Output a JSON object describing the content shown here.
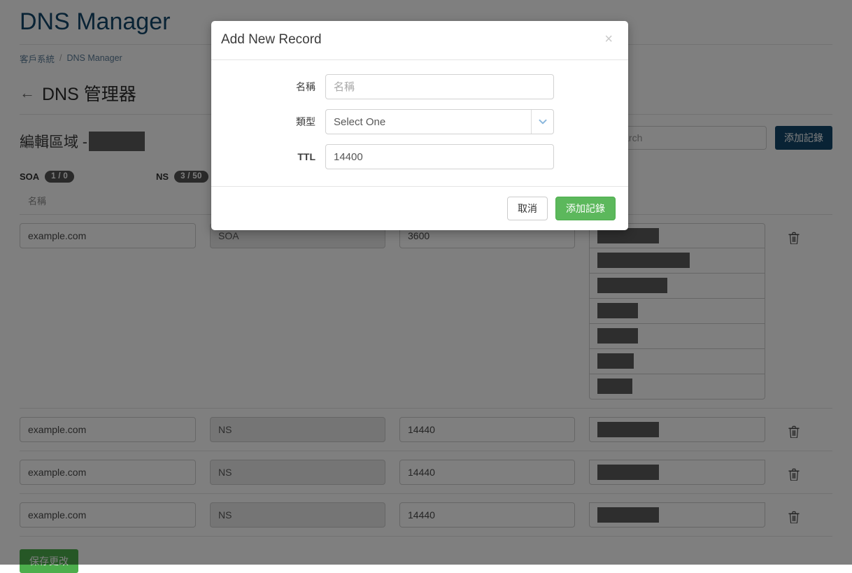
{
  "page": {
    "title": "DNS Manager",
    "breadcrumb": {
      "root": "客戶系統",
      "separator": "/",
      "current": "DNS Manager"
    },
    "subheader": {
      "back_icon": "left-arrow-icon",
      "label": "DNS 管理器"
    },
    "zone": {
      "label": "編輯區域 -",
      "name_redacted": true
    },
    "search": {
      "placeholder": "Search",
      "value": ""
    },
    "add_record_button": "添加記錄",
    "save_button": "保存更改",
    "counts": [
      {
        "type": "SOA",
        "badge": "1 / 0"
      },
      {
        "type": "NS",
        "badge": "3 / 50"
      }
    ],
    "columns": [
      "名稱",
      "",
      "",
      "",
      ""
    ],
    "records": [
      {
        "name": "example.com",
        "type": "SOA",
        "ttl": "3600",
        "values": [
          {
            "redacted_width": 88
          },
          {
            "redacted_width": 132
          },
          {
            "redacted_width": 100
          },
          {
            "redacted_width": 58
          },
          {
            "redacted_width": 58
          },
          {
            "redacted_width": 52
          },
          {
            "redacted_width": 50
          }
        ],
        "delete_icon": "trash-icon"
      },
      {
        "name": "example.com",
        "type": "NS",
        "ttl": "14440",
        "values": [
          {
            "redacted_width": 88
          }
        ],
        "delete_icon": "trash-icon"
      },
      {
        "name": "example.com",
        "type": "NS",
        "ttl": "14440",
        "values": [
          {
            "redacted_width": 88
          }
        ],
        "delete_icon": "trash-icon"
      },
      {
        "name": "example.com",
        "type": "NS",
        "ttl": "14440",
        "values": [
          {
            "redacted_width": 88
          }
        ],
        "delete_icon": "trash-icon"
      }
    ]
  },
  "modal": {
    "title": "Add New Record",
    "close_icon": "close-icon",
    "fields": {
      "name": {
        "label": "名稱",
        "placeholder": "名稱",
        "value": ""
      },
      "type": {
        "label": "類型",
        "selected": "Select One",
        "chevron_icon": "chevron-down-icon"
      },
      "ttl": {
        "label": "TTL",
        "value": "14400"
      }
    },
    "cancel_button": "取消",
    "submit_button": "添加記錄"
  },
  "colors": {
    "title": "#13476b",
    "primary_button": "#13476b",
    "success_button": "#5cb85c",
    "save_button": "#4cae4c",
    "redaction": "#5c5c5c",
    "overlay": "rgba(0,0,0,0.5)",
    "chevron": "#8bb7dd"
  }
}
